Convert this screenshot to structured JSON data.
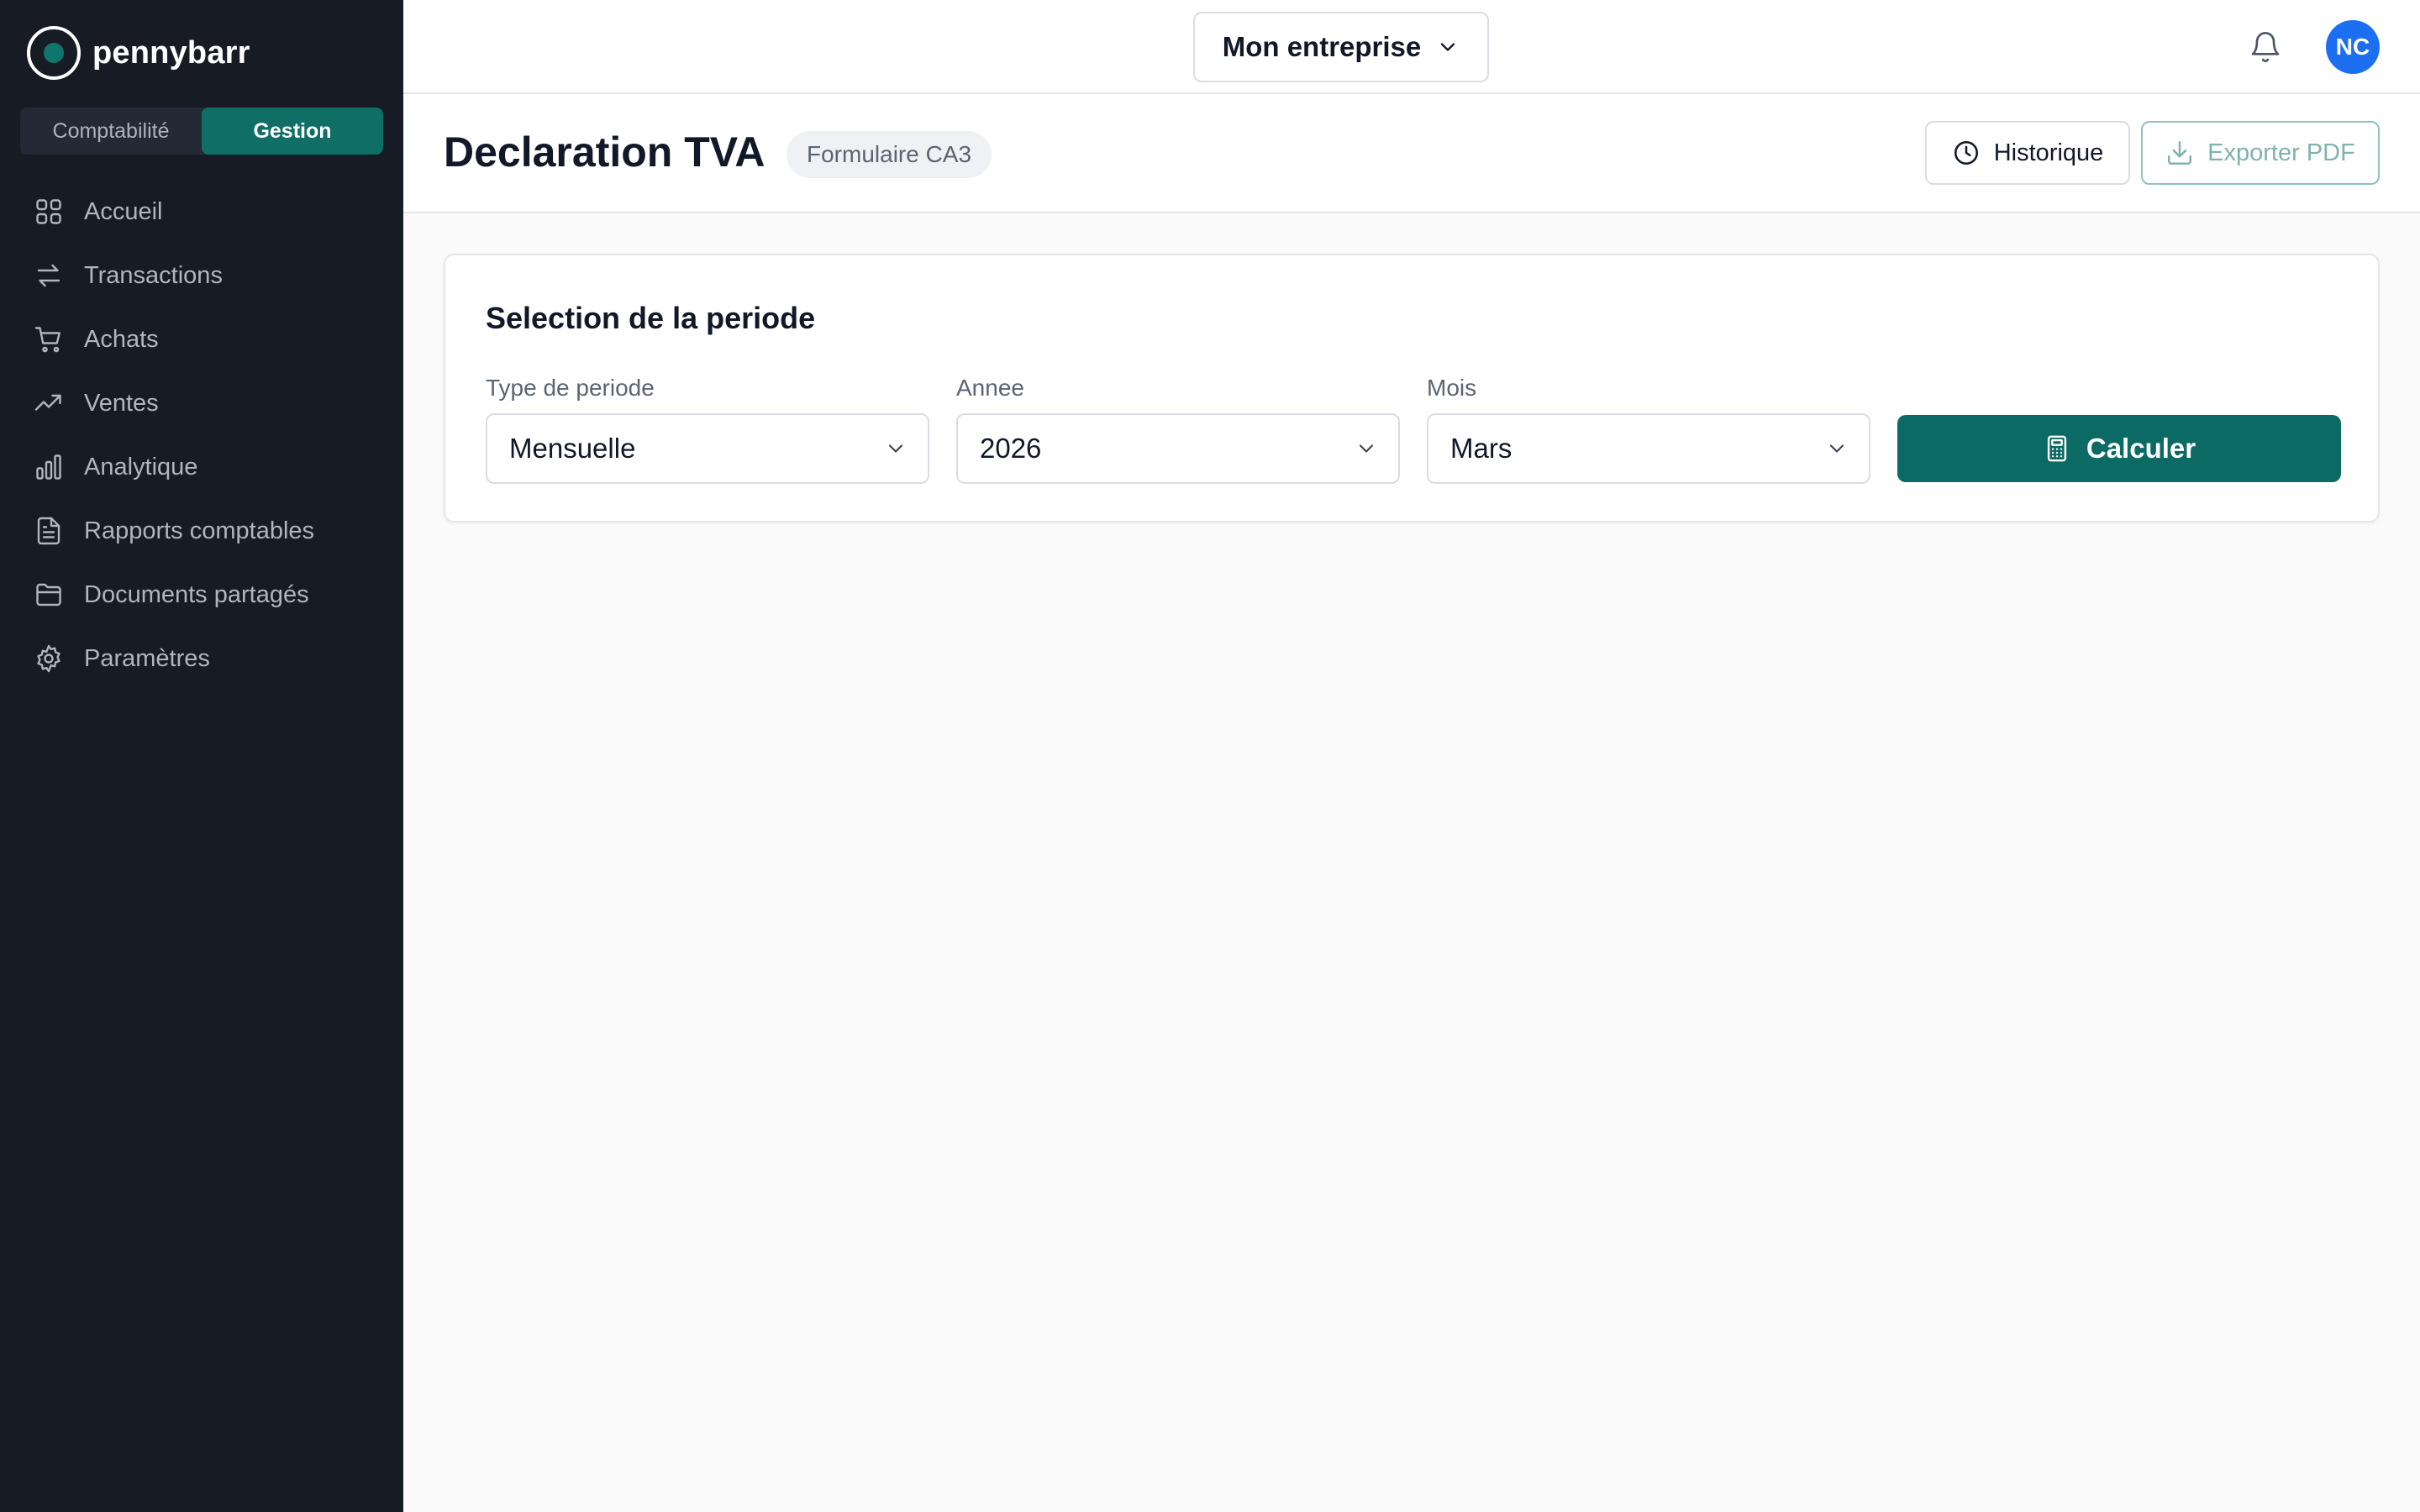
{
  "brand": {
    "name": "pennybarr"
  },
  "mode_switch": {
    "items": [
      "Comptabilité",
      "Gestion"
    ],
    "active": "Gestion"
  },
  "sidebar": {
    "items": [
      {
        "label": "Accueil",
        "icon": "grid-icon"
      },
      {
        "label": "Transactions",
        "icon": "arrows-exchange-icon"
      },
      {
        "label": "Achats",
        "icon": "shopping-cart-icon"
      },
      {
        "label": "Ventes",
        "icon": "trending-up-icon"
      },
      {
        "label": "Analytique",
        "icon": "bar-chart-icon"
      },
      {
        "label": "Rapports comptables",
        "icon": "file-text-icon"
      },
      {
        "label": "Documents partagés",
        "icon": "folder-icon"
      },
      {
        "label": "Paramètres",
        "icon": "gear-icon"
      }
    ]
  },
  "topbar": {
    "company": "Mon entreprise",
    "avatar_initials": "NC",
    "icons": [
      "bell-icon",
      "chevron-down-icon"
    ]
  },
  "page": {
    "title": "Declaration TVA",
    "badge": "Formulaire CA3",
    "history_label": "Historique",
    "export_label": "Exporter PDF"
  },
  "period_card": {
    "title": "Selection de la periode",
    "fields": [
      {
        "label": "Type de periode",
        "value": "Mensuelle"
      },
      {
        "label": "Annee",
        "value": "2026"
      },
      {
        "label": "Mois",
        "value": "Mars"
      }
    ],
    "submit_label": "Calculer"
  },
  "colors": {
    "sidebar_bg": "#161b24",
    "accent": "#0b6a63",
    "avatar": "#1d6ff2",
    "page_bg": "#fafafa"
  }
}
